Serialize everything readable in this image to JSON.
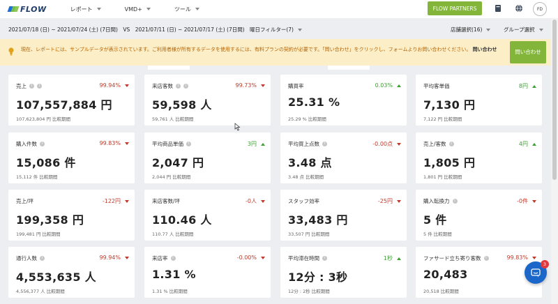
{
  "app": {
    "logo_text": "FLOW"
  },
  "nav": [
    {
      "label": "レポート"
    },
    {
      "label": "VMD+"
    },
    {
      "label": "ツール"
    }
  ],
  "header": {
    "partners_label": "FLOW PARTNERS",
    "avatar_initials": "FD"
  },
  "filters": {
    "current_range": "2021/07/18 (日) ~ 2021/07/24 (土) (7日間)",
    "vs_label": "VS",
    "compare_range": "2021/07/11 (日) ~ 2021/07/17 (土) (7日間)",
    "weekday_filter": "曜日フィルター(7)",
    "store_select": "店舗選択(16)",
    "group_select": "グループ選択"
  },
  "notice": {
    "text": "現在、レポートには、サンプルデータが表示されています。ご利用者様が所有するデータを使用するには、有料プランの契約が必要です。「問い合わせ」をクリックし、フォームよりお問い合わせください。",
    "link": "問い合わせ",
    "button_label": "問い合わせ",
    "colors": {
      "background": "#fcefc8",
      "text": "#b56200",
      "button": "#82b53a"
    }
  },
  "metrics": [
    {
      "label": "売上",
      "info_icons": 2,
      "change": "99.94%",
      "direction": "down",
      "value": "107,557,884 円",
      "previous": "107,623,804 円 比較期間"
    },
    {
      "label": "来店客数",
      "info_icons": 2,
      "change": "99.73%",
      "direction": "down",
      "value": "59,598 人",
      "previous": "59,761 人 比較期間"
    },
    {
      "label": "購買率",
      "info_icons": 0,
      "change": "0.03%",
      "direction": "up",
      "value": "25.31 %",
      "previous": "25.29 % 比較期間"
    },
    {
      "label": "平均客単価",
      "info_icons": 0,
      "change": "8円",
      "direction": "up",
      "value": "7,130 円",
      "previous": "7,122 円 比較期間"
    },
    {
      "label": "購入件数",
      "info_icons": 1,
      "change": "99.83%",
      "direction": "down",
      "value": "15,086 件",
      "previous": "15,112 件 比較期間"
    },
    {
      "label": "平均商品単価",
      "info_icons": 1,
      "change": "3円",
      "direction": "up",
      "value": "2,047 円",
      "previous": "2,044 円 比較期間"
    },
    {
      "label": "平均買上点数",
      "info_icons": 1,
      "change": "-0.00点",
      "direction": "down",
      "value": "3.48 点",
      "previous": "3.48 点 比較期間"
    },
    {
      "label": "売上/客数",
      "info_icons": 1,
      "change": "4円",
      "direction": "up",
      "value": "1,805 円",
      "previous": "1,801 円 比較期間"
    },
    {
      "label": "売上/坪",
      "info_icons": 0,
      "change": "-122円",
      "direction": "down",
      "value": "199,358 円",
      "previous": "199,481 円 比較期間"
    },
    {
      "label": "来店客数/坪",
      "info_icons": 0,
      "change": "-0人",
      "direction": "down",
      "value": "110.46 人",
      "previous": "110.77 人 比較期間"
    },
    {
      "label": "スタッフ効率",
      "info_icons": 0,
      "change": "-25円",
      "direction": "down",
      "value": "33,483 円",
      "previous": "33,507 円 比較期間"
    },
    {
      "label": "購入転換力",
      "info_icons": 1,
      "change": "-0件",
      "direction": "down",
      "value": "5 件",
      "previous": "5 件 比較期間"
    },
    {
      "label": "通行人数",
      "info_icons": 1,
      "change": "99.94%",
      "direction": "down",
      "value": "4,553,635 人",
      "previous": "4,556,377 人 比較期間"
    },
    {
      "label": "来店率",
      "info_icons": 1,
      "change": "-0.00%",
      "direction": "down",
      "value": "1.31 %",
      "previous": "1.31 % 比較期間"
    },
    {
      "label": "平均滞在時間",
      "info_icons": 1,
      "change": "1秒",
      "direction": "up",
      "value": "12分 : 3秒",
      "previous": "12分 : 2秒 比較期間"
    },
    {
      "label": "ファサード立ち寄り客数",
      "info_icons": 1,
      "change": "99.83%",
      "direction": "down",
      "value": "20,483",
      "previous": "20,518 比較期間"
    }
  ],
  "chat": {
    "badge_count": "3"
  },
  "colors": {
    "accent_green": "#82b53a",
    "up": "#3ca033",
    "down": "#c0392b",
    "chat": "#1a66c9"
  }
}
